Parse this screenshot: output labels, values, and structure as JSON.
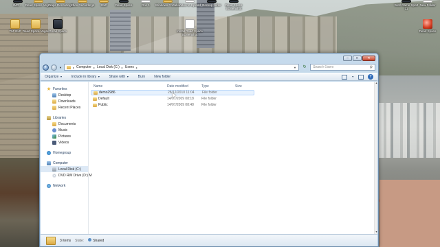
{
  "desktop": {
    "icons": [
      {
        "label": "IMG ..."
      },
      {
        "label": "Dead Space Vegas"
      },
      {
        "label": "Fraps Recordings"
      },
      {
        "label": "Xbox Recordings"
      },
      {
        "label": "Stuff"
      },
      {
        "label": "Dead Space"
      },
      {
        "label": "Doc 1"
      },
      {
        "label": "Windows Portable"
      },
      {
        "label": "Video to Upload"
      },
      {
        "label": "Backup folder"
      },
      {
        "label": "Dead Space Screenshot"
      },
      {
        "label": "Wolf Game Sport 11"
      },
      {
        "label": "New Folder"
      },
      {
        "label": "TM Stuff"
      },
      {
        "label": "Dead Space Vegas"
      },
      {
        "label": "Gmail Space"
      },
      {
        "label": "Install Dead Space Screenshot"
      },
      {
        "label": "Dead Space"
      }
    ]
  },
  "window": {
    "controls": {
      "minimize": "–",
      "maximize": "□",
      "close": "✕"
    },
    "address": {
      "crumbs": [
        "Computer",
        "Local Disk (C:)",
        "Users"
      ],
      "search_placeholder": "Search Users"
    },
    "toolbar": {
      "organize": "Organize",
      "include_in_library": "Include in library",
      "share_with": "Share with",
      "burn": "Burn",
      "new_folder": "New folder"
    },
    "nav": {
      "favorites": "Favorites",
      "desktop": "Desktop",
      "downloads": "Downloads",
      "recent_places": "Recent Places",
      "libraries": "Libraries",
      "documents": "Documents",
      "music": "Music",
      "pictures": "Pictures",
      "videos": "Videos",
      "homegroup": "Homegroup",
      "computer": "Computer",
      "local_disk": "Local Disk (C:)",
      "dvd_drive": "DVD RW Drive (D:) M",
      "network": "Network"
    },
    "columns": {
      "name": "Name",
      "date_modified": "Date modified",
      "type": "Type",
      "size": "Size"
    },
    "files": [
      {
        "name": "demo2986",
        "date": "28/12/2010 11:04",
        "type": "File folder"
      },
      {
        "name": "Default",
        "date": "14/07/2009 08:18",
        "type": "File folder"
      },
      {
        "name": "Public",
        "date": "14/07/2009 08:48",
        "type": "File folder"
      }
    ],
    "details": {
      "count": "3 items",
      "state_label": "State:",
      "state_value": "Shared"
    }
  },
  "icons": {
    "back": "back-arrow-icon",
    "forward": "forward-arrow-icon",
    "refresh": "refresh-icon",
    "search": "search-icon",
    "help": "help-icon"
  }
}
